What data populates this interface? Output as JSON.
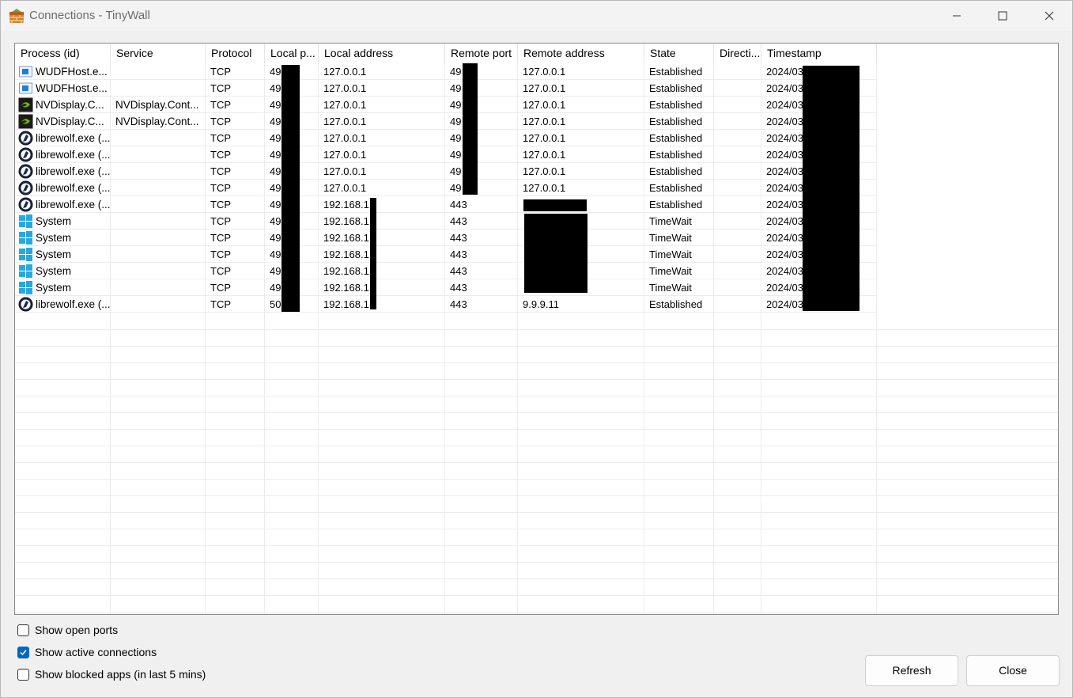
{
  "window": {
    "title": "Connections - TinyWall",
    "icon": "tinywall-firewall-icon",
    "controls": [
      "minimize-icon",
      "maximize-icon",
      "close-icon"
    ]
  },
  "table": {
    "columns": [
      "Process (id)",
      "Service",
      "Protocol",
      "Local p...",
      "Local address",
      "Remote port",
      "Remote address",
      "State",
      "Directi...",
      "Timestamp"
    ],
    "rows": [
      {
        "icon": "wudfhost-icon",
        "process": "WUDFHost.e...",
        "service": "",
        "protocol": "TCP",
        "local_port": "49",
        "local_address": "127.0.0.1",
        "remote_port": "49",
        "remote_address": "127.0.0.1",
        "state": "Established",
        "direction": "",
        "timestamp": "2024/03"
      },
      {
        "icon": "wudfhost-icon",
        "process": "WUDFHost.e...",
        "service": "",
        "protocol": "TCP",
        "local_port": "49",
        "local_address": "127.0.0.1",
        "remote_port": "49",
        "remote_address": "127.0.0.1",
        "state": "Established",
        "direction": "",
        "timestamp": "2024/03"
      },
      {
        "icon": "nvidia-icon",
        "process": "NVDisplay.C...",
        "service": "NVDisplay.Cont...",
        "protocol": "TCP",
        "local_port": "49",
        "local_address": "127.0.0.1",
        "remote_port": "49",
        "remote_address": "127.0.0.1",
        "state": "Established",
        "direction": "",
        "timestamp": "2024/03"
      },
      {
        "icon": "nvidia-icon",
        "process": "NVDisplay.C...",
        "service": "NVDisplay.Cont...",
        "protocol": "TCP",
        "local_port": "49",
        "local_address": "127.0.0.1",
        "remote_port": "49",
        "remote_address": "127.0.0.1",
        "state": "Established",
        "direction": "",
        "timestamp": "2024/03"
      },
      {
        "icon": "librewolf-icon",
        "process": "librewolf.exe (...",
        "service": "",
        "protocol": "TCP",
        "local_port": "49",
        "local_address": "127.0.0.1",
        "remote_port": "49",
        "remote_address": "127.0.0.1",
        "state": "Established",
        "direction": "",
        "timestamp": "2024/03"
      },
      {
        "icon": "librewolf-icon",
        "process": "librewolf.exe (...",
        "service": "",
        "protocol": "TCP",
        "local_port": "49",
        "local_address": "127.0.0.1",
        "remote_port": "49",
        "remote_address": "127.0.0.1",
        "state": "Established",
        "direction": "",
        "timestamp": "2024/03"
      },
      {
        "icon": "librewolf-icon",
        "process": "librewolf.exe (...",
        "service": "",
        "protocol": "TCP",
        "local_port": "49",
        "local_address": "127.0.0.1",
        "remote_port": "49",
        "remote_address": "127.0.0.1",
        "state": "Established",
        "direction": "",
        "timestamp": "2024/03"
      },
      {
        "icon": "librewolf-icon",
        "process": "librewolf.exe (...",
        "service": "",
        "protocol": "TCP",
        "local_port": "49",
        "local_address": "127.0.0.1",
        "remote_port": "49",
        "remote_address": "127.0.0.1",
        "state": "Established",
        "direction": "",
        "timestamp": "2024/03"
      },
      {
        "icon": "librewolf-icon",
        "process": "librewolf.exe (...",
        "service": "",
        "protocol": "TCP",
        "local_port": "49",
        "local_address": "192.168.1.",
        "remote_port": "443",
        "remote_address": "",
        "state": "Established",
        "direction": "",
        "timestamp": "2024/03"
      },
      {
        "icon": "windows-system-icon",
        "process": "System",
        "service": "",
        "protocol": "TCP",
        "local_port": "49",
        "local_address": "192.168.1.",
        "remote_port": "443",
        "remote_address": "",
        "state": "TimeWait",
        "direction": "",
        "timestamp": "2024/03"
      },
      {
        "icon": "windows-system-icon",
        "process": "System",
        "service": "",
        "protocol": "TCP",
        "local_port": "49",
        "local_address": "192.168.1.",
        "remote_port": "443",
        "remote_address": "",
        "state": "TimeWait",
        "direction": "",
        "timestamp": "2024/03"
      },
      {
        "icon": "windows-system-icon",
        "process": "System",
        "service": "",
        "protocol": "TCP",
        "local_port": "49",
        "local_address": "192.168.1.",
        "remote_port": "443",
        "remote_address": "",
        "state": "TimeWait",
        "direction": "",
        "timestamp": "2024/03"
      },
      {
        "icon": "windows-system-icon",
        "process": "System",
        "service": "",
        "protocol": "TCP",
        "local_port": "49",
        "local_address": "192.168.1.",
        "remote_port": "443",
        "remote_address": "",
        "state": "TimeWait",
        "direction": "",
        "timestamp": "2024/03"
      },
      {
        "icon": "windows-system-icon",
        "process": "System",
        "service": "",
        "protocol": "TCP",
        "local_port": "49",
        "local_address": "192.168.1.",
        "remote_port": "443",
        "remote_address": "",
        "state": "TimeWait",
        "direction": "",
        "timestamp": "2024/03"
      },
      {
        "icon": "librewolf-icon",
        "process": "librewolf.exe (...",
        "service": "",
        "protocol": "TCP",
        "local_port": "50",
        "local_address": "192.168.1.",
        "remote_port": "443",
        "remote_address": "9.9.9.11",
        "state": "Established",
        "direction": "",
        "timestamp": "2024/03"
      }
    ]
  },
  "options": {
    "show_open_ports": {
      "label": "Show open ports",
      "checked": false
    },
    "show_active_connections": {
      "label": "Show active connections",
      "checked": true
    },
    "show_blocked_apps": {
      "label": "Show blocked apps (in last 5 mins)",
      "checked": false
    }
  },
  "buttons": {
    "refresh": "Refresh",
    "close": "Close"
  },
  "colors": {
    "checkbox_accent": "#0067c0",
    "redaction": "#000000"
  }
}
